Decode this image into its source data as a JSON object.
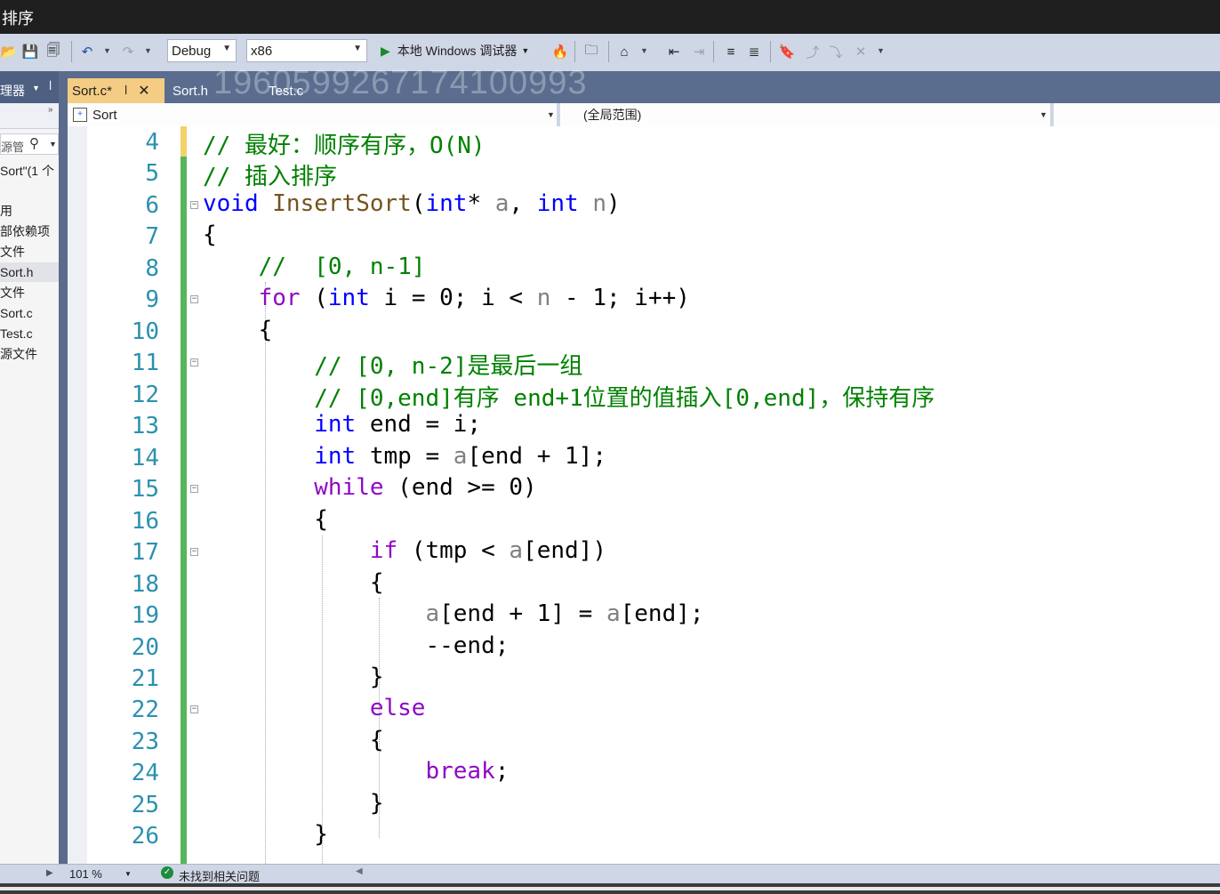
{
  "window": {
    "title": "排序"
  },
  "toolbar": {
    "config": "Debug",
    "platform": "x86",
    "run_label": "本地 Windows 调试器"
  },
  "solution_explorer": {
    "title": "理器",
    "search_text": "源管",
    "items": [
      {
        "label": "Sort\"(1 个"
      },
      {
        "label": "用"
      },
      {
        "label": "部依赖项"
      },
      {
        "label": "文件"
      },
      {
        "label": "Sort.h"
      },
      {
        "label": "文件"
      },
      {
        "label": "Sort.c"
      },
      {
        "label": "Test.c"
      },
      {
        "label": "源文件"
      }
    ]
  },
  "tabs": [
    {
      "label": "Sort.c*",
      "active": true
    },
    {
      "label": "Sort.h",
      "active": false
    },
    {
      "label": "Test.c",
      "active": false
    }
  ],
  "watermark": "1960599267174100993",
  "navbar": {
    "project": "Sort",
    "scope": "(全局范围)"
  },
  "editor": {
    "lines": [
      {
        "num": "4",
        "text": "// 最好：顺序有序，O(N)"
      },
      {
        "num": "5",
        "text": "// 插入排序"
      },
      {
        "num": "6",
        "text": "void InsertSort(int* a, int n)"
      },
      {
        "num": "7",
        "text": "{"
      },
      {
        "num": "8",
        "text": "    //  [0, n-1]"
      },
      {
        "num": "9",
        "text": "    for (int i = 0; i < n - 1; i++)"
      },
      {
        "num": "10",
        "text": "    {"
      },
      {
        "num": "11",
        "text": "        // [0, n-2]是最后一组"
      },
      {
        "num": "12",
        "text": "        // [0,end]有序 end+1位置的值插入[0,end]，保持有序"
      },
      {
        "num": "13",
        "text": "        int end = i;"
      },
      {
        "num": "14",
        "text": "        int tmp = a[end + 1];"
      },
      {
        "num": "15",
        "text": "        while (end >= 0)"
      },
      {
        "num": "16",
        "text": "        {"
      },
      {
        "num": "17",
        "text": "            if (tmp < a[end])"
      },
      {
        "num": "18",
        "text": "            {"
      },
      {
        "num": "19",
        "text": "                a[end + 1] = a[end];"
      },
      {
        "num": "20",
        "text": "                --end;"
      },
      {
        "num": "21",
        "text": "            }"
      },
      {
        "num": "22",
        "text": "            else"
      },
      {
        "num": "23",
        "text": "            {"
      },
      {
        "num": "24",
        "text": "                break;"
      },
      {
        "num": "25",
        "text": "            }"
      },
      {
        "num": "26",
        "text": "        }"
      }
    ]
  },
  "status": {
    "zoom": "101 %",
    "issues": "未找到相关问题"
  },
  "colors": {
    "keyword": "#0000ff",
    "control": "#8f08c4",
    "comment": "#008000",
    "function": "#74531f",
    "line_number": "#2b91af",
    "active_tab": "#f5cc84",
    "change_bar": "#57b55d"
  }
}
